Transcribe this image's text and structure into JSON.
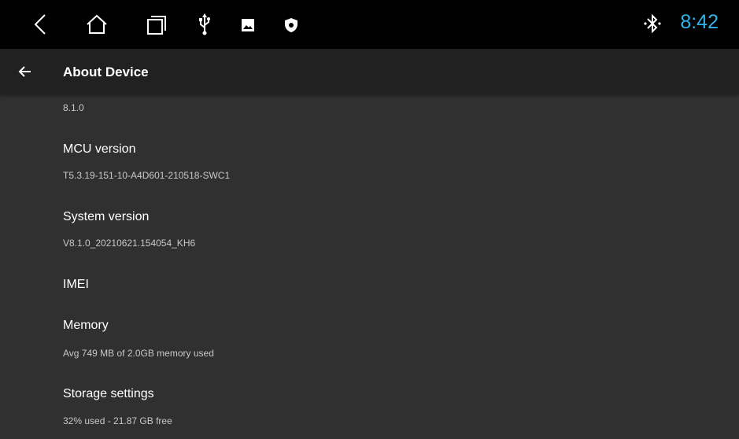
{
  "status_bar": {
    "nav_icons": [
      "back-icon",
      "home-icon",
      "recents-icon",
      "usb-icon",
      "image-icon",
      "shield-icon"
    ],
    "bluetooth_icon": "bluetooth-icon",
    "clock": "8:42",
    "clock_color": "#2fb4ea"
  },
  "app_bar": {
    "title": "About Device",
    "back_icon": "arrow-back-icon"
  },
  "preferences": {
    "android_version_summary": "8.1.0",
    "mcu": {
      "title": "MCU version",
      "summary": "T5.3.19-151-10-A4D601-210518-SWC1"
    },
    "system": {
      "title": "System version",
      "summary": "V8.1.0_20210621.154054_KH6"
    },
    "imei": {
      "title": "IMEI"
    },
    "memory": {
      "title": "Memory",
      "summary": "Avg 749 MB of 2.0GB memory used"
    },
    "storage": {
      "title": "Storage settings",
      "summary": "32% used - 21.87 GB free"
    }
  }
}
